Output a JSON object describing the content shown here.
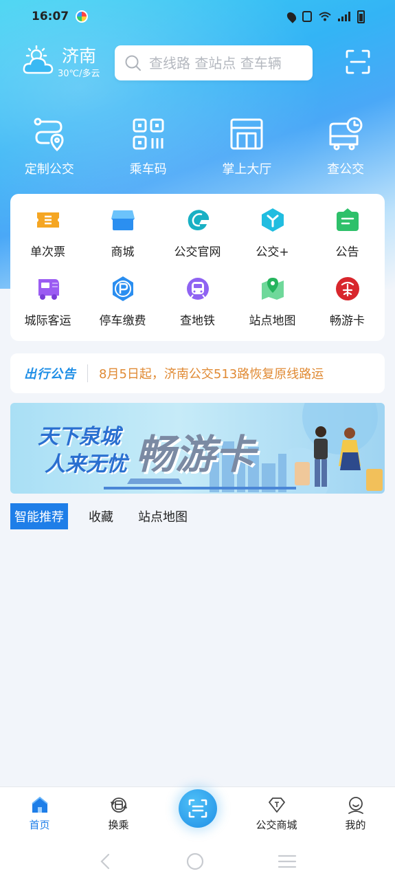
{
  "status_bar": {
    "time": "16:07"
  },
  "header": {
    "city": "济南",
    "weather": "30℃/多云",
    "search_placeholder": "查线路 查站点 查车辆"
  },
  "quick_actions": [
    {
      "label": "定制公交",
      "icon": "custom-bus-route-icon"
    },
    {
      "label": "乘车码",
      "icon": "qr-ride-code-icon"
    },
    {
      "label": "掌上大厅",
      "icon": "service-hall-icon"
    },
    {
      "label": "查公交",
      "icon": "bus-clock-icon"
    }
  ],
  "menu": [
    {
      "label": "单次票",
      "icon": "ticket-icon",
      "color": "#f5a623"
    },
    {
      "label": "商城",
      "icon": "shop-icon",
      "color": "#2b9af3"
    },
    {
      "label": "公交官网",
      "icon": "official-site-icon",
      "color": "#1fb5c9"
    },
    {
      "label": "公交+",
      "icon": "bus-plus-icon",
      "color": "#21bde0"
    },
    {
      "label": "公告",
      "icon": "announcement-icon",
      "color": "#2ec06a"
    },
    {
      "label": "城际客运",
      "icon": "intercity-bus-icon",
      "color": "#9b5cf2"
    },
    {
      "label": "停车缴费",
      "icon": "parking-icon",
      "color": "#2a8ef0"
    },
    {
      "label": "查地铁",
      "icon": "metro-icon",
      "color": "#8f63f2"
    },
    {
      "label": "站点地图",
      "icon": "station-map-icon",
      "color": "#34c46b"
    },
    {
      "label": "畅游卡",
      "icon": "tour-card-icon",
      "color": "#d8262c"
    }
  ],
  "notice": {
    "tag": "出行公告",
    "text": "8月5日起，济南公交513路恢复原线路运"
  },
  "banner": {
    "slogan_line1": "天下泉城",
    "slogan_line2": "人来无忧",
    "title": "畅游卡"
  },
  "tabs": [
    {
      "label": "智能推荐",
      "active": true
    },
    {
      "label": "收藏",
      "active": false
    },
    {
      "label": "站点地图",
      "active": false
    }
  ],
  "bottom_nav": {
    "home": "首页",
    "transfer": "换乘",
    "mall": "公交商城",
    "mine": "我的"
  },
  "colors": {
    "accent": "#1e7ee8",
    "notice_text": "#e08a34"
  }
}
